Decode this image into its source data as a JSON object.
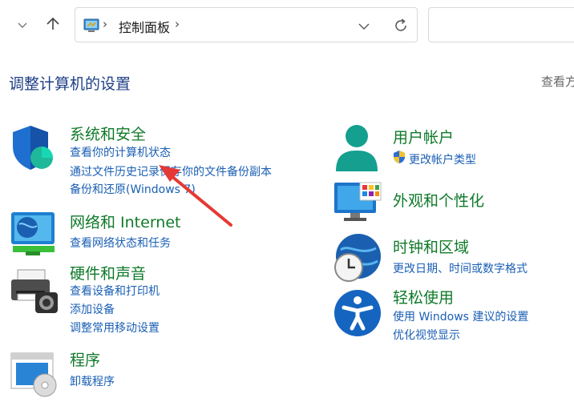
{
  "address_bar": {
    "location": "控制面板",
    "separator": "›"
  },
  "page_title": "调整计算机的设置",
  "view_by_label": "查看方",
  "categories": {
    "system_security": {
      "title": "系统和安全",
      "links": [
        "查看你的计算机状态",
        "通过文件历史记录保存你的文件备份副本",
        "备份和还原(Windows 7)"
      ]
    },
    "network": {
      "title": "网络和 Internet",
      "links": [
        "查看网络状态和任务"
      ]
    },
    "hardware": {
      "title": "硬件和声音",
      "links": [
        "查看设备和打印机",
        "添加设备",
        "调整常用移动设置"
      ]
    },
    "programs": {
      "title": "程序",
      "links": [
        "卸载程序"
      ]
    },
    "user_accounts": {
      "title": "用户帐户",
      "links": [
        "更改帐户类型"
      ]
    },
    "appearance": {
      "title": "外观和个性化"
    },
    "clock_region": {
      "title": "时钟和区域",
      "links": [
        "更改日期、时间或数字格式"
      ]
    },
    "ease_access": {
      "title": "轻松使用",
      "links": [
        "使用 Windows 建议的设置",
        "优化视觉显示"
      ]
    }
  },
  "colors": {
    "category_title": "#0f7a2a",
    "link": "#1a5fb4",
    "page_title": "#1f3f86",
    "annotation_arrow": "#e53935"
  },
  "icons": [
    "chevron-down-icon",
    "up-arrow-icon",
    "control-panel-icon",
    "refresh-icon",
    "shield-icon",
    "globe-network-icon",
    "printer-icon",
    "programs-icon",
    "user-icon",
    "monitor-palette-icon",
    "clock-globe-icon",
    "accessibility-icon",
    "uac-shield-icon"
  ]
}
